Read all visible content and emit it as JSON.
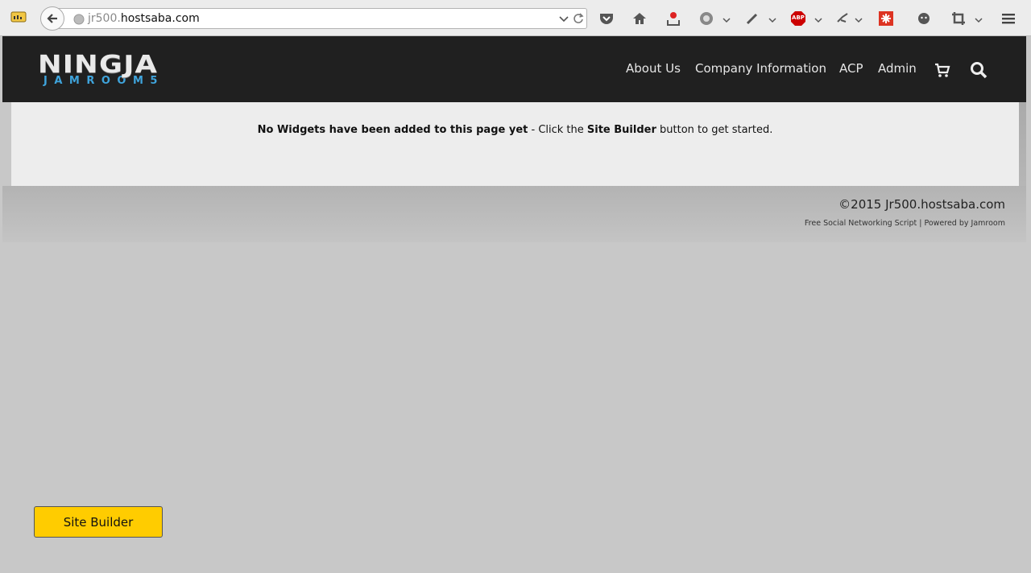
{
  "browser": {
    "url_subdomain": "jr500.",
    "url_domain": "hostsaba.com",
    "icons": [
      "page-icon",
      "back-icon",
      "globe-icon",
      "dropdown-icon",
      "reload-icon",
      "pocket-icon",
      "home-icon",
      "download-icon",
      "addon-gear-icon",
      "eyedropper-icon",
      "adblock-icon",
      "bug-icon",
      "lastpass-icon",
      "chat-icon",
      "crop-icon",
      "menu-icon"
    ],
    "adblock_label": "ABP"
  },
  "site": {
    "logo_top": "NINGJA",
    "logo_bottom": "JAMROOM5",
    "nav": [
      "About Us",
      "Company Information",
      "ACP",
      "Admin"
    ]
  },
  "main": {
    "notice_bold": "No Widgets have been added to this page yet",
    "notice_mid": " - Click the ",
    "notice_bold2": "Site Builder",
    "notice_end": " button to get started."
  },
  "footer": {
    "copyright": "©2015 Jr500.hostsaba.com",
    "link_social": "Free Social Networking Script",
    "separator": " | ",
    "link_powered": "Powered by Jamroom"
  },
  "site_builder_label": "Site Builder",
  "colors": {
    "header_bg": "#202020",
    "accent_blue": "#3fa4dc",
    "site_builder_bg": "#ffcc00",
    "page_bg": "#c8c8c8"
  }
}
